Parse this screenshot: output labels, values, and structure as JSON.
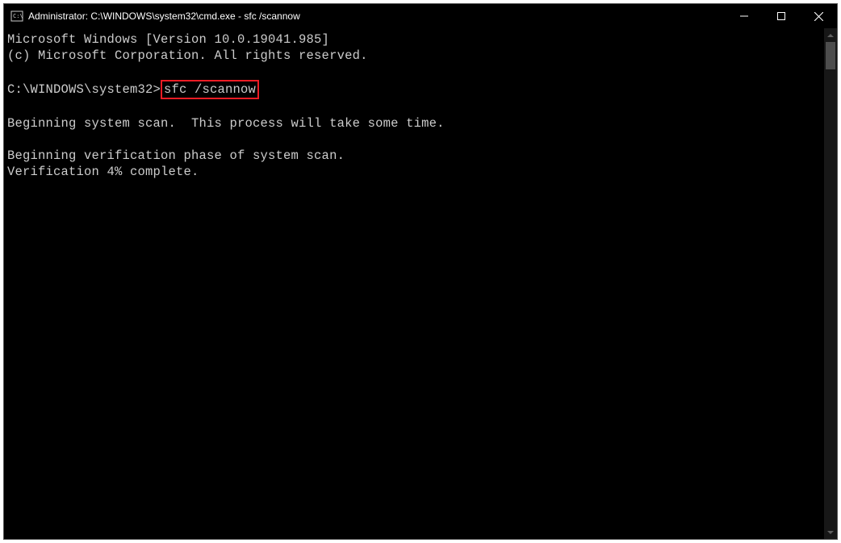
{
  "window": {
    "title": "Administrator: C:\\WINDOWS\\system32\\cmd.exe - sfc  /scannow"
  },
  "terminal": {
    "line1": "Microsoft Windows [Version 10.0.19041.985]",
    "line2": "(c) Microsoft Corporation. All rights reserved.",
    "prompt": "C:\\WINDOWS\\system32>",
    "highlighted_command": "sfc /scannow",
    "scan_begin": "Beginning system scan.  This process will take some time.",
    "verify_phase": "Beginning verification phase of system scan.",
    "verify_progress": "Verification 4% complete."
  }
}
